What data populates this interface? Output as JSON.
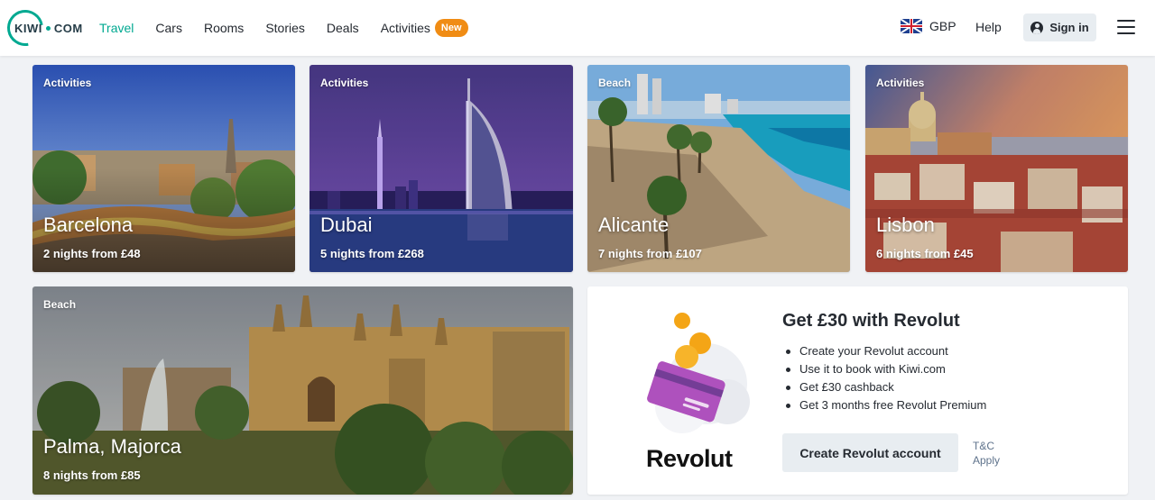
{
  "header": {
    "logo_text_left": "KIWI",
    "logo_text_right": "COM",
    "nav": [
      {
        "label": "Travel",
        "active": true
      },
      {
        "label": "Cars"
      },
      {
        "label": "Rooms"
      },
      {
        "label": "Stories"
      },
      {
        "label": "Deals"
      },
      {
        "label": "Activities",
        "badge": "New"
      }
    ],
    "currency": "GBP",
    "help": "Help",
    "signin": "Sign in"
  },
  "cards": [
    {
      "tag": "Activities",
      "city": "Barcelona",
      "price": "2 nights from £48"
    },
    {
      "tag": "Activities",
      "city": "Dubai",
      "price": "5 nights from £268"
    },
    {
      "tag": "Beach",
      "city": "Alicante",
      "price": "7 nights from £107"
    },
    {
      "tag": "Activities",
      "city": "Lisbon",
      "price": "6 nights from £45"
    },
    {
      "tag": "Beach",
      "city": "Palma, Majorca",
      "price": "8 nights from £85"
    }
  ],
  "promo": {
    "title": "Get £30 with Revolut",
    "items": [
      "Create your Revolut account",
      "Use it to book with Kiwi.com",
      "Get £30 cashback",
      "Get 3 months free Revolut Premium"
    ],
    "logo": "Revolut",
    "button": "Create Revolut account",
    "tc_line1": "T&C",
    "tc_line2": "Apply"
  },
  "colors": {
    "accent": "#00a991",
    "badge": "#f08c14"
  }
}
